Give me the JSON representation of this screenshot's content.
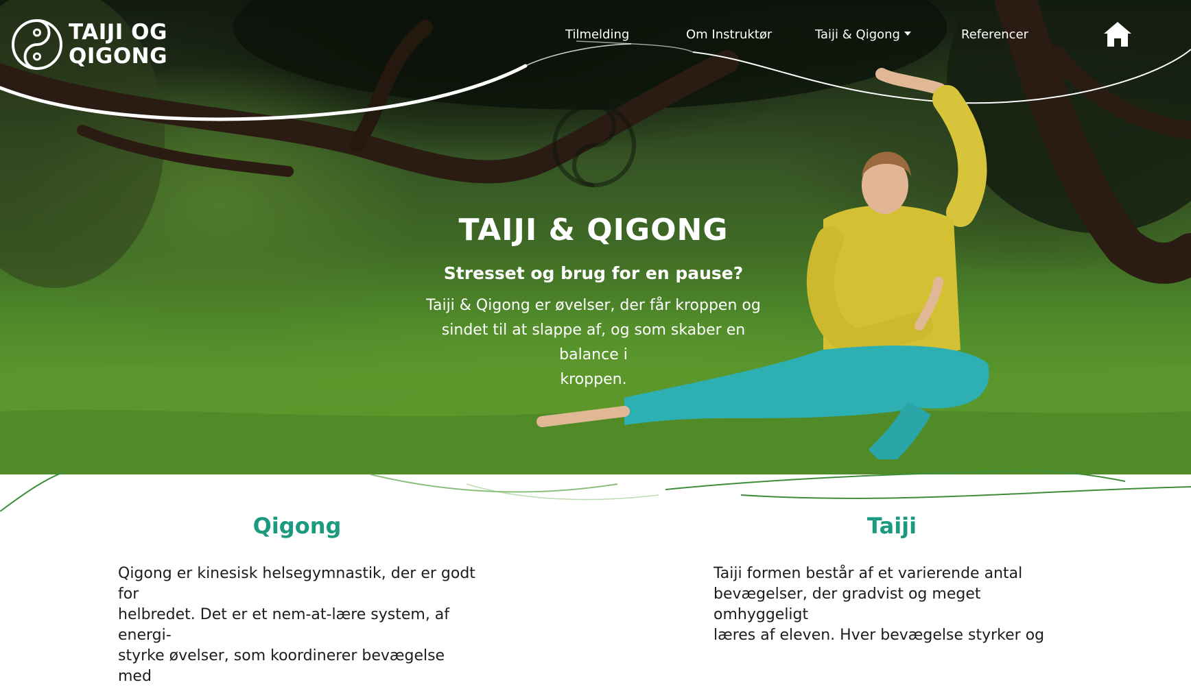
{
  "logo": {
    "line1": "TAIJI OG",
    "line2": "QIGONG",
    "icon": "yin-yang-icon"
  },
  "nav": {
    "items": [
      {
        "label": "Tilmelding"
      },
      {
        "label": "Om Instruktør"
      },
      {
        "label": "Taiji & Qigong",
        "has_dropdown": true
      },
      {
        "label": "Referencer"
      }
    ],
    "home_icon": "home-icon"
  },
  "hero": {
    "title": "TAIJI & QIGONG",
    "subtitle": "Stresset og brug for en pause?",
    "text_lines": [
      "Taiji & Qigong er øvelser, der får kroppen og",
      "sindet til at slappe af, og som skaber en balance i",
      "kroppen."
    ]
  },
  "sections": [
    {
      "title": "Qigong",
      "text_lines": [
        "Qigong er kinesisk helsegymnastik, der er godt for",
        "helbredet. Det er et nem-at-lære system, af energi-",
        "styrke øvelser, som koordinerer bevægelse med"
      ]
    },
    {
      "title": "Taiji",
      "text_lines": [
        "Taiji formen består af et varierende antal",
        "bevægelser, der gradvist og meget omhyggeligt",
        "læres af eleven. Hver bevægelse styrker og"
      ]
    }
  ],
  "colors": {
    "accent": "#1c9a7f",
    "text": "#1c1c1c",
    "white": "#ffffff",
    "wave_green": "#3f8c3a"
  }
}
